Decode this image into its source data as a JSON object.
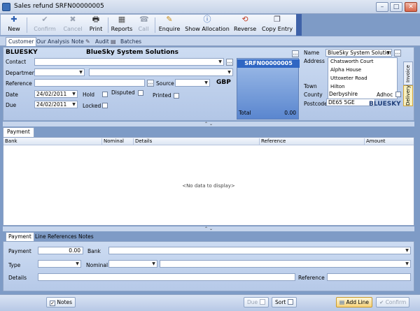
{
  "window": {
    "title": "Sales refund SRFN00000005",
    "minimize": "–",
    "maximize": "□",
    "close": "✕"
  },
  "toolbar": {
    "buttons": [
      {
        "label": "New",
        "icon": "plus-icon",
        "glyph": "✚",
        "enabled": true
      },
      {
        "label": "Confirm",
        "icon": "check-icon",
        "glyph": "✔",
        "enabled": false
      },
      {
        "label": "Cancel",
        "icon": "cross-icon",
        "glyph": "✖",
        "enabled": false
      },
      {
        "label": "Print",
        "icon": "printer-icon",
        "glyph": "🖶",
        "enabled": true
      },
      {
        "label": "Reports",
        "icon": "reports-icon",
        "glyph": "▦",
        "enabled": true
      },
      {
        "label": "Call",
        "icon": "phone-icon",
        "glyph": "☎",
        "enabled": false
      },
      {
        "label": "Enquire",
        "icon": "enquire-icon",
        "glyph": "✎",
        "enabled": true
      },
      {
        "label": "Show Allocation",
        "icon": "info-icon",
        "glyph": "ⓘ",
        "enabled": true
      },
      {
        "label": "Reverse",
        "icon": "reverse-icon",
        "glyph": "⟲",
        "enabled": true
      },
      {
        "label": "Copy Entry",
        "icon": "copy-icon",
        "glyph": "❐",
        "enabled": true
      }
    ]
  },
  "top_tabs": [
    "Customer",
    "Our Analysis",
    "Note",
    "Audit",
    "Batches"
  ],
  "header": {
    "account": "BLUESKY",
    "account_name": "BlueSky System Solutions",
    "labels": {
      "contact": "Contact",
      "department": "Department",
      "reference": "Reference",
      "source": "Source",
      "date": "Date",
      "due": "Due",
      "hold": "Hold",
      "disputed": "Disputed",
      "printed": "Printed",
      "locked": "Locked",
      "total": "Total",
      "name": "Name",
      "address": "Address",
      "town": "Town",
      "county": "County",
      "postcode": "Postcode",
      "adhoc": "Adhoc"
    },
    "currency": "GBP",
    "date_value": "24/02/2011",
    "due_value": "24/02/2011",
    "doc_number": "SRFN00000005",
    "total_value": "0.00",
    "name_value": "BlueSky System Solution",
    "address_lines": [
      "Chatsworth Court",
      "Alpha House",
      "Uttoxeter Road",
      "Hilton"
    ],
    "county_value": "Derbyshire",
    "postcode_value": "DE65 5GE",
    "brand": "BLUESKY",
    "side_tabs": [
      "Invoice",
      "Delivery"
    ],
    "ellipsis": "..."
  },
  "payment_tab": "Payment",
  "grid": {
    "columns": [
      "Bank",
      "Nominal",
      "Details",
      "Reference",
      "Amount"
    ],
    "empty_text": "<No data to display>"
  },
  "bottom_tabs": [
    "Payment",
    "Line References",
    "Notes"
  ],
  "detail": {
    "labels": {
      "payment": "Payment",
      "bank": "Bank",
      "type": "Type",
      "nominal": "Nominal",
      "details": "Details",
      "reference": "Reference"
    },
    "payment_value": "0.00"
  },
  "status": {
    "notes": "Notes",
    "due": "Due",
    "sort": "Sort",
    "add_line": "Add Line",
    "confirm": "Confirm"
  }
}
